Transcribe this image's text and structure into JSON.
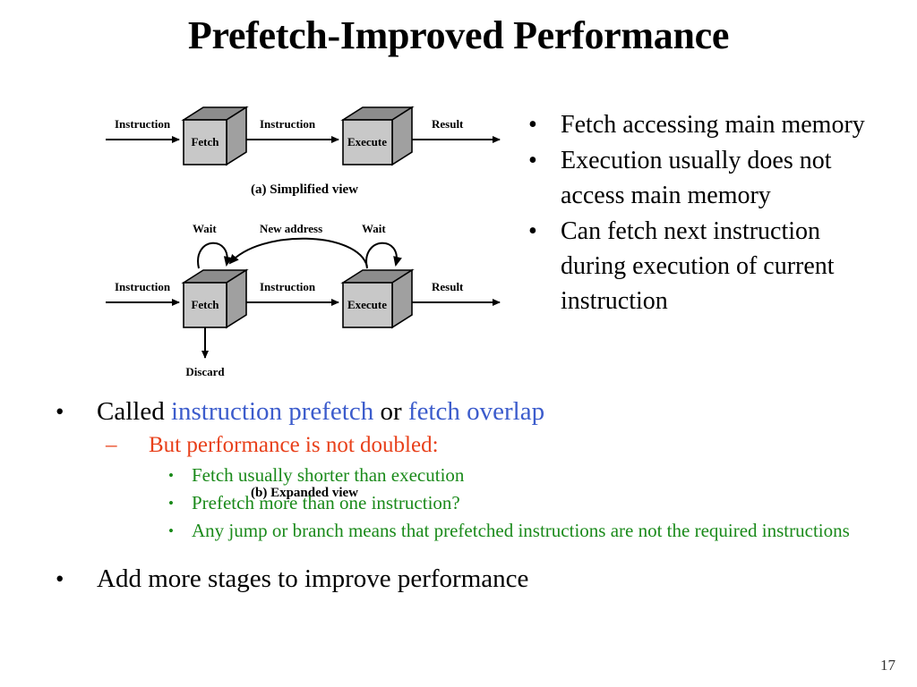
{
  "slide": {
    "title": "Prefetch-Improved Performance",
    "page_number": "17"
  },
  "colors": {
    "keyword_blue": "#3C5CCC",
    "level2_red": "#E8401A",
    "level3_green": "#1A8A1A",
    "box_front": "#C8C8C8",
    "box_top": "#8C8C8C",
    "box_side": "#A0A0A0",
    "outline": "#000000"
  },
  "figure": {
    "diagram_a": {
      "caption": "(a) Simplified view",
      "boxes": [
        {
          "label": "Fetch"
        },
        {
          "label": "Execute"
        }
      ],
      "arrow_labels": {
        "input": "Instruction",
        "middle": "Instruction",
        "output": "Result"
      }
    },
    "diagram_b": {
      "caption": "(b) Expanded view",
      "boxes": [
        {
          "label": "Fetch"
        },
        {
          "label": "Execute"
        }
      ],
      "arrow_labels": {
        "input": "Instruction",
        "middle": "Instruction",
        "output": "Result",
        "wait_fetch": "Wait",
        "wait_execute": "Wait",
        "new_address": "New address",
        "discard": "Discard"
      }
    }
  },
  "right_column": {
    "bullet_glyph": "•",
    "items": [
      "Fetch accessing main memory",
      "Execution usually does not access main memory",
      "Can fetch next instruction during execution of current instruction"
    ]
  },
  "lower_list": {
    "bullet_glyph": "•",
    "dash_glyph": "–",
    "called_prefix": "Called ",
    "called_keyword1": "instruction prefetch",
    "called_middle": " or ",
    "called_keyword2": "fetch overlap",
    "not_doubled": "But performance is not doubled:",
    "green_items": [
      "Fetch usually shorter than execution",
      "Prefetch more than one instruction?",
      "Any jump or branch means that prefetched instructions are not the required instructions"
    ],
    "add_stages": "Add more stages to improve performance"
  }
}
